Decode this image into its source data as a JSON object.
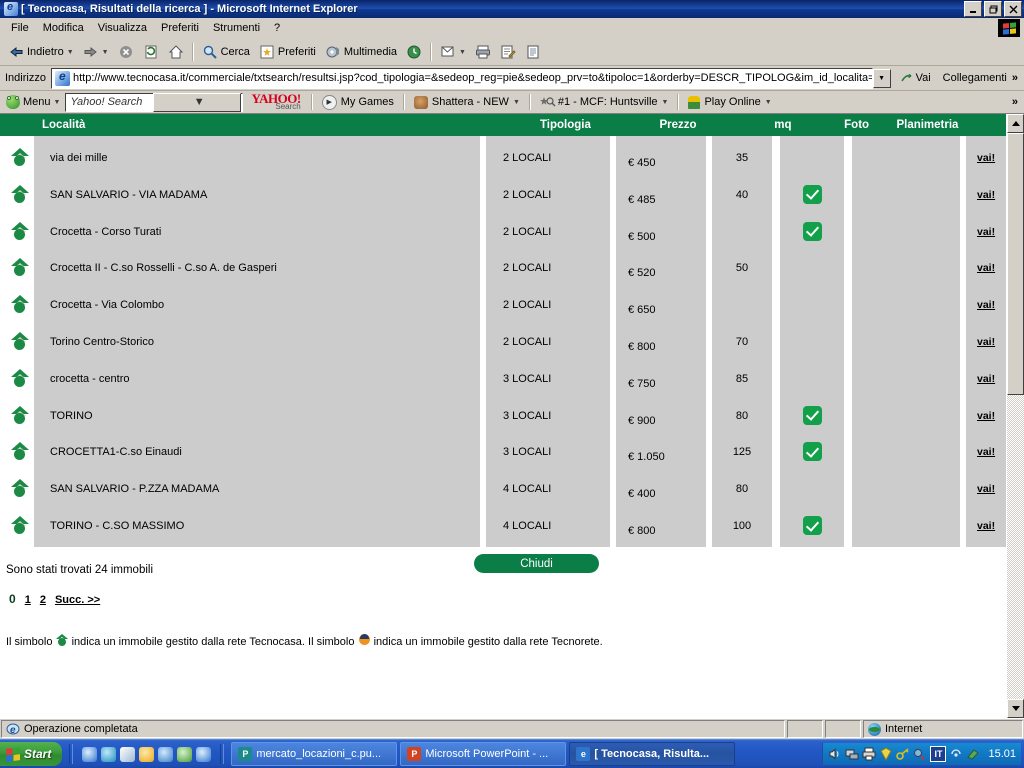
{
  "window": {
    "title": "[ Tecnocasa, Risultati della ricerca ] - Microsoft Internet Explorer",
    "minimize": "_",
    "restore": "❐",
    "close": "✕"
  },
  "menubar": {
    "items": [
      "File",
      "Modifica",
      "Visualizza",
      "Preferiti",
      "Strumenti",
      "?"
    ]
  },
  "toolbar": {
    "back": "Indietro",
    "forward": "",
    "stop": "stop-icon",
    "refresh": "refresh-icon",
    "home": "home-icon",
    "search": "Cerca",
    "favorites": "Preferiti",
    "media": "Multimedia",
    "history": "history-icon",
    "mail": "mail-icon",
    "print": "print-icon",
    "edit": "edit-icon",
    "discuss": "discuss-icon"
  },
  "address": {
    "label": "Indirizzo",
    "url": "http://www.tecnocasa.it/commerciale/txtsearch/resultsi.jsp?cod_tipologia=&sedeop_reg=pie&sedeop_prv=to&tipoloc=1&orderby=DESCR_TIPOLOG&im_id_localita=",
    "go": "Vai",
    "links": "Collegamenti",
    "chevron": "»"
  },
  "yahoo_bar": {
    "menu": "Menu",
    "search_placeholder": "Yahoo! Search",
    "logo_top": "YAHOO!",
    "logo_sub": "Search",
    "buttons": [
      "My Games",
      "Shattera - NEW",
      "#1 - MCF: Huntsville",
      "Play Online"
    ],
    "overflow": "»"
  },
  "table": {
    "columns": [
      "Località",
      "Tipologia",
      "Prezzo",
      "mq",
      "Foto",
      "Planimetria"
    ],
    "rows": [
      {
        "localita": "via dei mille",
        "tipologia": "2 LOCALI",
        "prezzo": "€ 450",
        "mq": "35",
        "foto": false,
        "planimetria": false,
        "action": "vai!"
      },
      {
        "localita": "SAN SALVARIO - VIA MADAMA",
        "tipologia": "2 LOCALI",
        "prezzo": "€ 485",
        "mq": "40",
        "foto": true,
        "planimetria": false,
        "action": "vai!"
      },
      {
        "localita": "Crocetta - Corso Turati",
        "tipologia": "2 LOCALI",
        "prezzo": "€ 500",
        "mq": "",
        "foto": true,
        "planimetria": false,
        "action": "vai!"
      },
      {
        "localita": "Crocetta II - C.so Rosselli - C.so A. de Gasperi",
        "tipologia": "2 LOCALI",
        "prezzo": "€ 520",
        "mq": "50",
        "foto": false,
        "planimetria": false,
        "action": "vai!"
      },
      {
        "localita": "Crocetta - Via Colombo",
        "tipologia": "2 LOCALI",
        "prezzo": "€ 650",
        "mq": "",
        "foto": false,
        "planimetria": false,
        "action": "vai!"
      },
      {
        "localita": "Torino Centro-Storico",
        "tipologia": "2 LOCALI",
        "prezzo": "€ 800",
        "mq": "70",
        "foto": false,
        "planimetria": false,
        "action": "vai!"
      },
      {
        "localita": "crocetta - centro",
        "tipologia": "3 LOCALI",
        "prezzo": "€ 750",
        "mq": "85",
        "foto": false,
        "planimetria": false,
        "action": "vai!"
      },
      {
        "localita": "TORINO",
        "tipologia": "3 LOCALI",
        "prezzo": "€ 900",
        "mq": "80",
        "foto": true,
        "planimetria": false,
        "action": "vai!"
      },
      {
        "localita": "CROCETTA1-C.so Einaudi",
        "tipologia": "3 LOCALI",
        "prezzo": "€ 1.050",
        "mq": "125",
        "foto": true,
        "planimetria": false,
        "action": "vai!"
      },
      {
        "localita": "SAN SALVARIO - P.ZZA MADAMA",
        "tipologia": "4 LOCALI",
        "prezzo": "€ 400",
        "mq": "80",
        "foto": false,
        "planimetria": false,
        "action": "vai!"
      },
      {
        "localita": "TORINO - C.SO MASSIMO",
        "tipologia": "4 LOCALI",
        "prezzo": "€ 800",
        "mq": "100",
        "foto": true,
        "planimetria": false,
        "action": "vai!"
      }
    ]
  },
  "results": {
    "found_text": "Sono stati trovati 24 immobili",
    "close_button": "Chiudi",
    "pagination": {
      "current": "0",
      "pages": [
        "1",
        "2"
      ],
      "next": "Succ. >>"
    },
    "legend_part1": "Il simbolo",
    "legend_part2": "indica un immobile gestito dalla rete Tecnocasa. Il simbolo",
    "legend_part3": "indica un immobile gestito dalla rete Tecnorete."
  },
  "status": {
    "text": "Operazione completata",
    "zone": "Internet"
  },
  "taskbar": {
    "start": "Start",
    "items": [
      {
        "label": "mercato_locazioni_c.pu...",
        "icon": "P",
        "icon_color": "#1a8a8a",
        "active": false
      },
      {
        "label": "Microsoft PowerPoint - ...",
        "icon": "P",
        "icon_color": "#d04423",
        "active": false
      },
      {
        "label": "[ Tecnocasa, Risulta...",
        "icon": "e",
        "icon_color": "#2f74cc",
        "active": true
      }
    ],
    "tray_lang": "IT",
    "clock": "15.01"
  },
  "colors": {
    "brand_green": "#0b7d46",
    "logo_green": "#1a8a44",
    "check_green": "#12a04a",
    "row_gray": "#cccccc",
    "chrome": "#d4d0c8"
  }
}
